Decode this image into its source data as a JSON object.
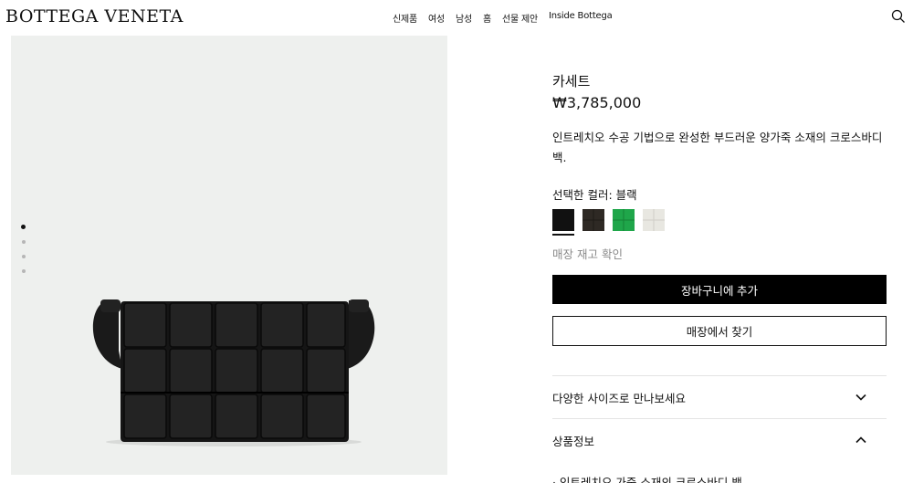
{
  "header": {
    "logo": "BOTTEGA VENETA",
    "nav": [
      "신제품",
      "여성",
      "남성",
      "홈",
      "선물 제안",
      "Inside Bottega"
    ],
    "search_icon": "search-icon"
  },
  "gallery": {
    "image_count": 4,
    "active_index": 0
  },
  "product": {
    "name": "카세트",
    "price": "₩3,785,000",
    "description": "인트레치오 수공 기법으로 완성한 부드러운 양가죽 소재의 크로스바디 백.",
    "color_label": "선택한 컬러: 블랙",
    "swatches": [
      {
        "name": "black",
        "color": "#111111"
      },
      {
        "name": "brown",
        "color": "#2e2924"
      },
      {
        "name": "green",
        "color": "#1fa64a"
      },
      {
        "name": "cream",
        "color": "#e8e7e1"
      }
    ],
    "stock_link": "매장 재고 확인",
    "add_to_cart": "장바구니에 추가",
    "find_in_store": "매장에서 찾기",
    "accordion": [
      {
        "label": "다양한 사이즈로 만나보세요",
        "icon": "chevron-down-icon"
      },
      {
        "label": "상품정보",
        "icon": "chevron-up-icon"
      }
    ],
    "info_first_bullet": "· 인트레치오 가죽 소재의 크로스바디 백"
  }
}
